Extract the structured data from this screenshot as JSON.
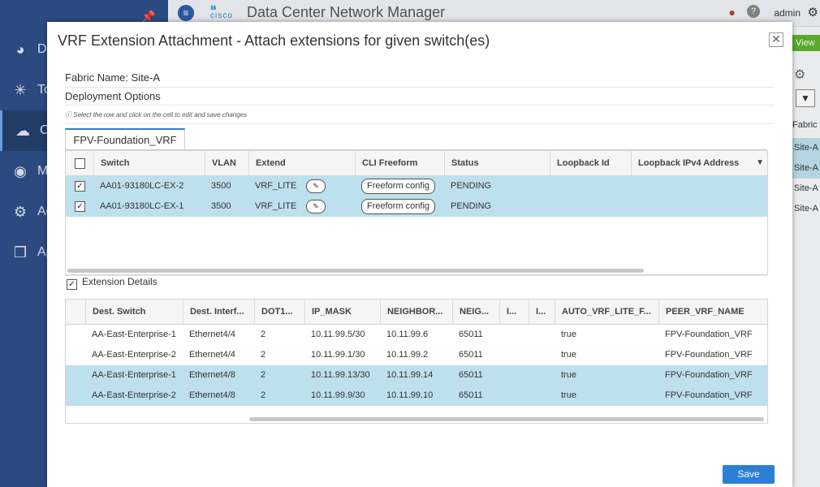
{
  "app": {
    "title": "Data Center Network Manager",
    "brand": "cisco",
    "user": "admin"
  },
  "sidebar": {
    "items": [
      {
        "label": "Da",
        "icon": "dashboard-icon"
      },
      {
        "label": "To",
        "icon": "topology-icon"
      },
      {
        "label": "Co",
        "icon": "control-icon"
      },
      {
        "label": "M",
        "icon": "monitor-icon"
      },
      {
        "label": "Ad",
        "icon": "administration-icon"
      },
      {
        "label": "Ap",
        "icon": "applications-icon"
      }
    ]
  },
  "background": {
    "view_button": "View",
    "column_header": "Fabric",
    "cells": [
      "Site-A",
      "Site-A",
      "Site-A",
      "Site-A"
    ]
  },
  "modal": {
    "title": "VRF Extension Attachment - Attach extensions for given switch(es)",
    "fabric_line": "Fabric Name: Site-A",
    "deployment_label": "Deployment Options",
    "hint": "Select the row and click on the cell to edit and save changes",
    "tab": "FPV-Foundation_VRF",
    "save_label": "Save"
  },
  "switch_table": {
    "headers": [
      "Switch",
      "VLAN",
      "Extend",
      "CLI Freeform",
      "Status",
      "Loopback Id",
      "Loopback IPv4 Address"
    ],
    "rows": [
      {
        "switch": "AA01-93180LC-EX-2",
        "vlan": "3500",
        "extend": "VRF_LITE",
        "freeform": "Freeform config",
        "status": "PENDING",
        "checked": true
      },
      {
        "switch": "AA01-93180LC-EX-1",
        "vlan": "3500",
        "extend": "VRF_LITE",
        "freeform": "Freeform config",
        "status": "PENDING",
        "checked": true
      }
    ]
  },
  "extension": {
    "label": "Extension Details",
    "checked": true,
    "headers": [
      "Dest. Switch",
      "Dest. Interf...",
      "DOT1...",
      "IP_MASK",
      "NEIGHBOR...",
      "NEIG...",
      "I...",
      "I...",
      "AUTO_VRF_LITE_F...",
      "PEER_VRF_NAME"
    ],
    "rows": [
      {
        "dest_switch": "AA-East-Enterprise-1",
        "interface": "Ethernet4/4",
        "dot1q": "2",
        "ip_mask": "10.11.99.5/30",
        "neighbor_ip": "10.11.99.6",
        "neighbor_asn": "65011",
        "auto": "true",
        "peer_vrf": "FPV-Foundation_VRF",
        "selected": false
      },
      {
        "dest_switch": "AA-East-Enterprise-2",
        "interface": "Ethernet4/4",
        "dot1q": "2",
        "ip_mask": "10.11.99.1/30",
        "neighbor_ip": "10.11.99.2",
        "neighbor_asn": "65011",
        "auto": "true",
        "peer_vrf": "FPV-Foundation_VRF",
        "selected": false
      },
      {
        "dest_switch": "AA-East-Enterprise-1",
        "interface": "Ethernet4/8",
        "dot1q": "2",
        "ip_mask": "10.11.99.13/30",
        "neighbor_ip": "10.11.99.14",
        "neighbor_asn": "65011",
        "auto": "true",
        "peer_vrf": "FPV-Foundation_VRF",
        "selected": true
      },
      {
        "dest_switch": "AA-East-Enterprise-2",
        "interface": "Ethernet4/8",
        "dot1q": "2",
        "ip_mask": "10.11.99.9/30",
        "neighbor_ip": "10.11.99.10",
        "neighbor_asn": "65011",
        "auto": "true",
        "peer_vrf": "FPV-Foundation_VRF",
        "selected": true
      }
    ]
  },
  "colors": {
    "sidebar": "#2e4f86",
    "selected_row": "#bde0ee",
    "primary": "#2a7fd4"
  }
}
